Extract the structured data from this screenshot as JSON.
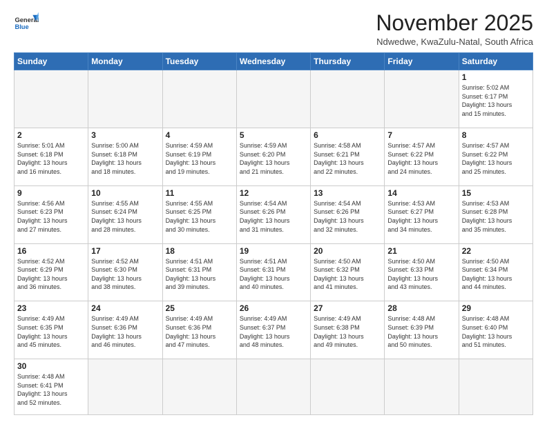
{
  "header": {
    "logo_general": "General",
    "logo_blue": "Blue",
    "month_title": "November 2025",
    "subtitle": "Ndwedwe, KwaZulu-Natal, South Africa"
  },
  "weekdays": [
    "Sunday",
    "Monday",
    "Tuesday",
    "Wednesday",
    "Thursday",
    "Friday",
    "Saturday"
  ],
  "days": [
    {
      "num": "",
      "info": ""
    },
    {
      "num": "",
      "info": ""
    },
    {
      "num": "",
      "info": ""
    },
    {
      "num": "",
      "info": ""
    },
    {
      "num": "",
      "info": ""
    },
    {
      "num": "",
      "info": ""
    },
    {
      "num": "1",
      "info": "Sunrise: 5:02 AM\nSunset: 6:17 PM\nDaylight: 13 hours\nand 15 minutes."
    },
    {
      "num": "2",
      "info": "Sunrise: 5:01 AM\nSunset: 6:18 PM\nDaylight: 13 hours\nand 16 minutes."
    },
    {
      "num": "3",
      "info": "Sunrise: 5:00 AM\nSunset: 6:18 PM\nDaylight: 13 hours\nand 18 minutes."
    },
    {
      "num": "4",
      "info": "Sunrise: 4:59 AM\nSunset: 6:19 PM\nDaylight: 13 hours\nand 19 minutes."
    },
    {
      "num": "5",
      "info": "Sunrise: 4:59 AM\nSunset: 6:20 PM\nDaylight: 13 hours\nand 21 minutes."
    },
    {
      "num": "6",
      "info": "Sunrise: 4:58 AM\nSunset: 6:21 PM\nDaylight: 13 hours\nand 22 minutes."
    },
    {
      "num": "7",
      "info": "Sunrise: 4:57 AM\nSunset: 6:22 PM\nDaylight: 13 hours\nand 24 minutes."
    },
    {
      "num": "8",
      "info": "Sunrise: 4:57 AM\nSunset: 6:22 PM\nDaylight: 13 hours\nand 25 minutes."
    },
    {
      "num": "9",
      "info": "Sunrise: 4:56 AM\nSunset: 6:23 PM\nDaylight: 13 hours\nand 27 minutes."
    },
    {
      "num": "10",
      "info": "Sunrise: 4:55 AM\nSunset: 6:24 PM\nDaylight: 13 hours\nand 28 minutes."
    },
    {
      "num": "11",
      "info": "Sunrise: 4:55 AM\nSunset: 6:25 PM\nDaylight: 13 hours\nand 30 minutes."
    },
    {
      "num": "12",
      "info": "Sunrise: 4:54 AM\nSunset: 6:26 PM\nDaylight: 13 hours\nand 31 minutes."
    },
    {
      "num": "13",
      "info": "Sunrise: 4:54 AM\nSunset: 6:26 PM\nDaylight: 13 hours\nand 32 minutes."
    },
    {
      "num": "14",
      "info": "Sunrise: 4:53 AM\nSunset: 6:27 PM\nDaylight: 13 hours\nand 34 minutes."
    },
    {
      "num": "15",
      "info": "Sunrise: 4:53 AM\nSunset: 6:28 PM\nDaylight: 13 hours\nand 35 minutes."
    },
    {
      "num": "16",
      "info": "Sunrise: 4:52 AM\nSunset: 6:29 PM\nDaylight: 13 hours\nand 36 minutes."
    },
    {
      "num": "17",
      "info": "Sunrise: 4:52 AM\nSunset: 6:30 PM\nDaylight: 13 hours\nand 38 minutes."
    },
    {
      "num": "18",
      "info": "Sunrise: 4:51 AM\nSunset: 6:31 PM\nDaylight: 13 hours\nand 39 minutes."
    },
    {
      "num": "19",
      "info": "Sunrise: 4:51 AM\nSunset: 6:31 PM\nDaylight: 13 hours\nand 40 minutes."
    },
    {
      "num": "20",
      "info": "Sunrise: 4:50 AM\nSunset: 6:32 PM\nDaylight: 13 hours\nand 41 minutes."
    },
    {
      "num": "21",
      "info": "Sunrise: 4:50 AM\nSunset: 6:33 PM\nDaylight: 13 hours\nand 43 minutes."
    },
    {
      "num": "22",
      "info": "Sunrise: 4:50 AM\nSunset: 6:34 PM\nDaylight: 13 hours\nand 44 minutes."
    },
    {
      "num": "23",
      "info": "Sunrise: 4:49 AM\nSunset: 6:35 PM\nDaylight: 13 hours\nand 45 minutes."
    },
    {
      "num": "24",
      "info": "Sunrise: 4:49 AM\nSunset: 6:36 PM\nDaylight: 13 hours\nand 46 minutes."
    },
    {
      "num": "25",
      "info": "Sunrise: 4:49 AM\nSunset: 6:36 PM\nDaylight: 13 hours\nand 47 minutes."
    },
    {
      "num": "26",
      "info": "Sunrise: 4:49 AM\nSunset: 6:37 PM\nDaylight: 13 hours\nand 48 minutes."
    },
    {
      "num": "27",
      "info": "Sunrise: 4:49 AM\nSunset: 6:38 PM\nDaylight: 13 hours\nand 49 minutes."
    },
    {
      "num": "28",
      "info": "Sunrise: 4:48 AM\nSunset: 6:39 PM\nDaylight: 13 hours\nand 50 minutes."
    },
    {
      "num": "29",
      "info": "Sunrise: 4:48 AM\nSunset: 6:40 PM\nDaylight: 13 hours\nand 51 minutes."
    },
    {
      "num": "30",
      "info": "Sunrise: 4:48 AM\nSunset: 6:41 PM\nDaylight: 13 hours\nand 52 minutes."
    },
    {
      "num": "",
      "info": ""
    },
    {
      "num": "",
      "info": ""
    },
    {
      "num": "",
      "info": ""
    },
    {
      "num": "",
      "info": ""
    },
    {
      "num": "",
      "info": ""
    },
    {
      "num": "",
      "info": ""
    }
  ]
}
